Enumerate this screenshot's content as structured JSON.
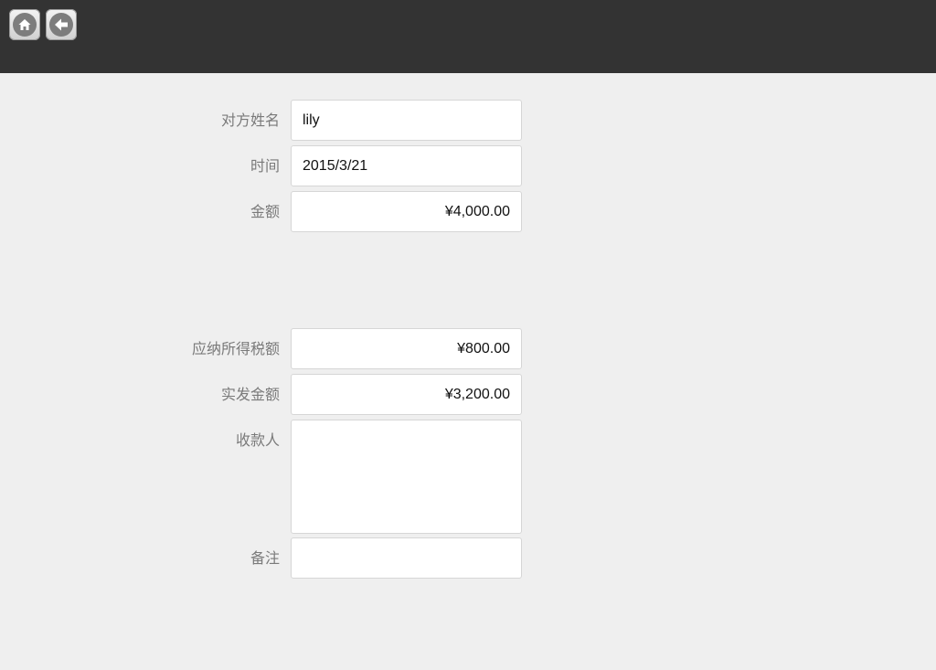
{
  "toolbar": {
    "home_icon": "home-icon",
    "back_icon": "back-arrow-icon"
  },
  "form": {
    "counterparty_name": {
      "label": "对方姓名",
      "value": "lily"
    },
    "date": {
      "label": "时间",
      "value": "2015/3/21"
    },
    "amount": {
      "label": "金额",
      "value": "¥4,000.00"
    },
    "taxable_amount": {
      "label": "应纳所得税额",
      "value": "¥800.00"
    },
    "net_amount": {
      "label": "实发金额",
      "value": "¥3,200.00"
    },
    "payee": {
      "label": "收款人",
      "value": ""
    },
    "remark": {
      "label": "备注",
      "value": ""
    }
  },
  "colors": {
    "topbar": "#333333",
    "background": "#efefef",
    "label": "#7a7a7a"
  }
}
